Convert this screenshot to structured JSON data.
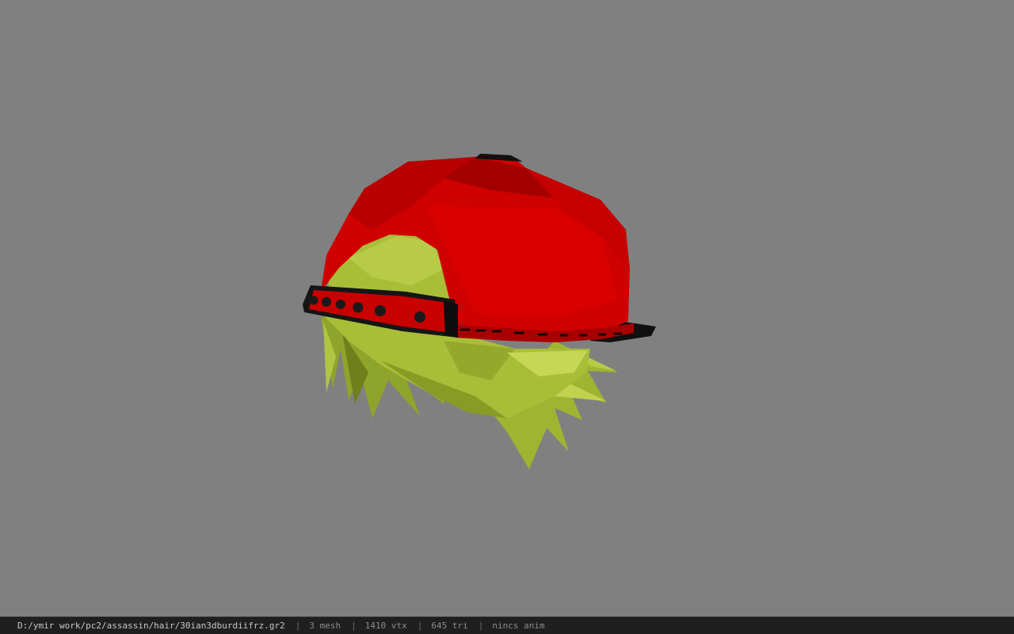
{
  "viewer": {
    "background_color": "#808080",
    "model": {
      "cap_color": "#d00000",
      "cap_shadow_color": "#9a0000",
      "strap_color": "#c40000",
      "hair_color": "#a6bb37",
      "hair_shadow_color": "#7d8f22",
      "brim_color": "#101010"
    }
  },
  "status": {
    "file_path": "D:/ymir work/pc2/assassin/hair/30ian3dburdiifrz.gr2",
    "separator": "|",
    "mesh_count": "3 mesh",
    "vertex_count": "1410 vtx",
    "triangle_count": "645 tri",
    "animation": "nincs anim"
  }
}
